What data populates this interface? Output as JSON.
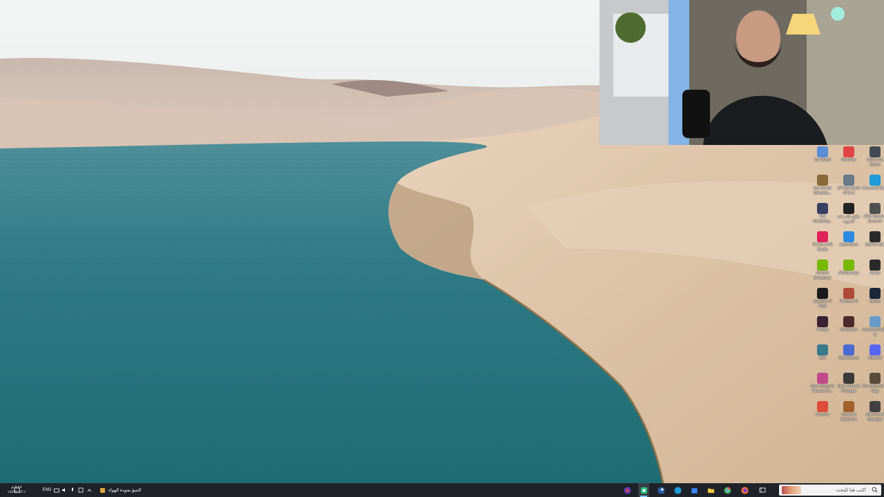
{
  "taskbar": {
    "search_placeholder": "اكتب هنا للبحث",
    "weather_text": "التنبؤ بجودة الهواء",
    "language": "ENG",
    "time": "٥:٤٤ م",
    "date": "١٤٤٧/٠٤/١١"
  },
  "desktop_icons": [
    {
      "label": "Ice World",
      "icon": "ice-world-icon",
      "color": "#5a8fd6"
    },
    {
      "label": "DouWan",
      "icon": "douwan-icon",
      "color": "#e04545"
    },
    {
      "label": "Hell is Us Demo",
      "icon": "hell-is-us-icon",
      "color": "#444a55"
    },
    {
      "label": "Car Dealer Simulato...",
      "icon": "car-dealer-icon",
      "color": "#8a6a3a"
    },
    {
      "label": "CPUID ASUS CPU-Z",
      "icon": "cpuz-icon",
      "color": "#6a7a88"
    },
    {
      "label": "Microsoft Edge",
      "icon": "edge-icon",
      "color": "#1e9bd7"
    },
    {
      "label": "The Vanishing...",
      "icon": "vanishing-icon",
      "color": "#3a3f66"
    },
    {
      "label": "تعرّف إلى هذه الصورة",
      "icon": "spotlight-icon",
      "color": "#222222"
    },
    {
      "label": "ARK Survival Evolved",
      "icon": "ark-icon",
      "color": "#505050"
    },
    {
      "label": "TikTok LIVE Studio",
      "icon": "tiktok-live-icon",
      "color": "#e0225a"
    },
    {
      "label": "AnkerWork",
      "icon": "ankerwork-icon",
      "color": "#2c8be0"
    },
    {
      "label": "MOTIV Mix",
      "icon": "motiv-mix-icon",
      "color": "#2a2a2a"
    },
    {
      "label": "NVIDIA Broadcast",
      "icon": "nvidia-broadcast-icon",
      "color": "#76b900"
    },
    {
      "label": "NVIDIA App",
      "icon": "nvidia-app-icon",
      "color": "#76b900"
    },
    {
      "label": "Portal",
      "icon": "portal-icon",
      "color": "#2a2a2a"
    },
    {
      "label": "Logitech G HUB",
      "icon": "ghub-icon",
      "color": "#1a1a1a"
    },
    {
      "label": "Hi Mom Hi",
      "icon": "game-icon",
      "color": "#b04a3a"
    },
    {
      "label": "Steam",
      "icon": "steam-icon",
      "color": "#1b2838"
    },
    {
      "label": "Perfidy",
      "icon": "perfidy-icon",
      "color": "#3a2030"
    },
    {
      "label": "Viewfinder",
      "icon": "viewfinder-icon",
      "color": "#4a2a2a"
    },
    {
      "label": "LosslessScaling",
      "icon": "lossless-icon",
      "color": "#6a9ac9"
    },
    {
      "label": "Bolt",
      "icon": "bolt-icon",
      "color": "#3a7a8a"
    },
    {
      "label": "GameBoost",
      "icon": "gameboost-icon",
      "color": "#4a6ad0"
    },
    {
      "label": "Discord",
      "icon": "discord-icon",
      "color": "#5865f2"
    },
    {
      "label": "Dave Beyond: Heaven Dr...",
      "icon": "dave-icon",
      "color": "#c04a8a"
    },
    {
      "label": "Dark Heaven Prologue",
      "icon": "dark-heaven-icon",
      "color": "#3a3a3a"
    },
    {
      "label": "The Children of Clay",
      "icon": "children-clay-icon",
      "color": "#5a4a3a"
    },
    {
      "label": "Chrome",
      "icon": "chrome-icon",
      "color": "#dd4b39"
    },
    {
      "label": "Chained Explorers",
      "icon": "chained-icon",
      "color": "#a0602a"
    },
    {
      "label": "Ark Server Manager",
      "icon": "ark-server-icon",
      "color": "#404040"
    }
  ],
  "colors": {
    "taskbar_bg": "#1f2329",
    "accent": "#7cc4ff"
  }
}
